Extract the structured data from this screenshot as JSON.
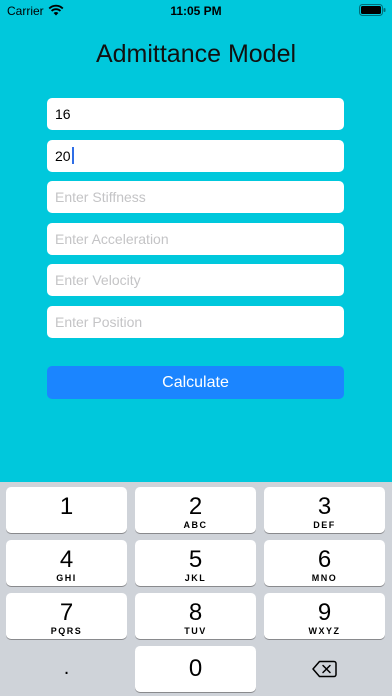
{
  "status_bar": {
    "carrier": "Carrier",
    "time": "11:05 PM"
  },
  "app": {
    "title": "Admittance Model",
    "fields": [
      {
        "value": "16",
        "placeholder": ""
      },
      {
        "value": "20",
        "placeholder": ""
      },
      {
        "value": "",
        "placeholder": "Enter Stiffness"
      },
      {
        "value": "",
        "placeholder": "Enter Acceleration"
      },
      {
        "value": "",
        "placeholder": "Enter Velocity"
      },
      {
        "value": "",
        "placeholder": "Enter Position"
      }
    ],
    "calculate_label": "Calculate"
  },
  "keyboard": {
    "keys": [
      {
        "digit": "1",
        "letters": ""
      },
      {
        "digit": "2",
        "letters": "ABC"
      },
      {
        "digit": "3",
        "letters": "DEF"
      },
      {
        "digit": "4",
        "letters": "GHI"
      },
      {
        "digit": "5",
        "letters": "JKL"
      },
      {
        "digit": "6",
        "letters": "MNO"
      },
      {
        "digit": "7",
        "letters": "PQRS"
      },
      {
        "digit": "8",
        "letters": "TUV"
      },
      {
        "digit": "9",
        "letters": "WXYZ"
      },
      {
        "digit": "0",
        "letters": ""
      }
    ],
    "decimal": ".",
    "delete_icon": "delete-backspace-icon"
  },
  "colors": {
    "background": "#00c8dc",
    "button": "#1b85ff",
    "keyboard": "#cfd3d9"
  }
}
